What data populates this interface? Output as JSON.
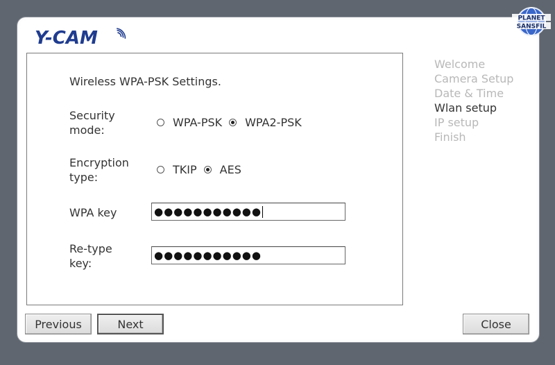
{
  "logo": {
    "text": "Y-CAM"
  },
  "form": {
    "heading": "Wireless WPA-PSK Settings.",
    "security_mode": {
      "label_line1": "Security",
      "label_line2": "mode:",
      "options": [
        {
          "label": "WPA-PSK",
          "checked": false
        },
        {
          "label": "WPA2-PSK",
          "checked": true
        }
      ]
    },
    "encryption_type": {
      "label_line1": "Encryption",
      "label_line2": "type:",
      "options": [
        {
          "label": "TKIP",
          "checked": false
        },
        {
          "label": "AES",
          "checked": true
        }
      ]
    },
    "wpa_key": {
      "label": "WPA key",
      "value": "●●●●●●●●●●●"
    },
    "retype_key": {
      "label_line1": "Re-type",
      "label_line2": "key:",
      "value": "●●●●●●●●●●●"
    }
  },
  "steps": [
    {
      "label": "Welcome",
      "active": false
    },
    {
      "label": "Camera Setup",
      "active": false
    },
    {
      "label": "Date & Time",
      "active": false
    },
    {
      "label": "Wlan setup",
      "active": true
    },
    {
      "label": "IP setup",
      "active": false
    },
    {
      "label": "Finish",
      "active": false
    }
  ],
  "buttons": {
    "previous": "Previous",
    "next": "Next",
    "close": "Close"
  },
  "brand": {
    "line1": "PLANET",
    "line2": "SANSFIL"
  },
  "colors": {
    "logo": "#1f3c8f",
    "background": "#5f6670",
    "inactive_step": "#b8b8b8"
  }
}
